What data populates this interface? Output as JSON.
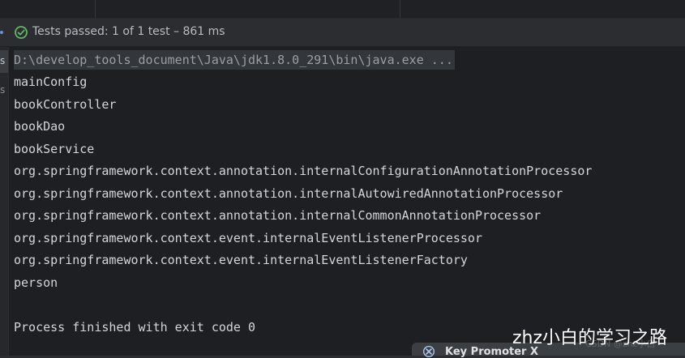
{
  "status": {
    "icon": "check-circle-icon",
    "text": "Tests passed: 1 of 1 test – 861 ms",
    "color": "#5fb865"
  },
  "gutter": {
    "letter_1": "s",
    "letter_2": "s"
  },
  "console": {
    "command": "D:\\develop_tools_document\\Java\\jdk1.8.0_291\\bin\\java.exe ...",
    "lines": [
      "mainConfig",
      "bookController",
      "bookDao",
      "bookService",
      "org.springframework.context.annotation.internalConfigurationAnnotationProcessor",
      "org.springframework.context.annotation.internalAutowiredAnnotationProcessor",
      "org.springframework.context.annotation.internalCommonAnnotationProcessor",
      "org.springframework.context.event.internalEventListenerProcessor",
      "org.springframework.context.event.internalEventListenerFactory",
      "person"
    ],
    "exit_message": "Process finished with exit code 0"
  },
  "watermark": {
    "text": "zhz小白的学习之路",
    "faint": "CSDN @zhz小白"
  },
  "popup": {
    "icon": "key-promoter-icon",
    "title": "Key Promoter X"
  }
}
